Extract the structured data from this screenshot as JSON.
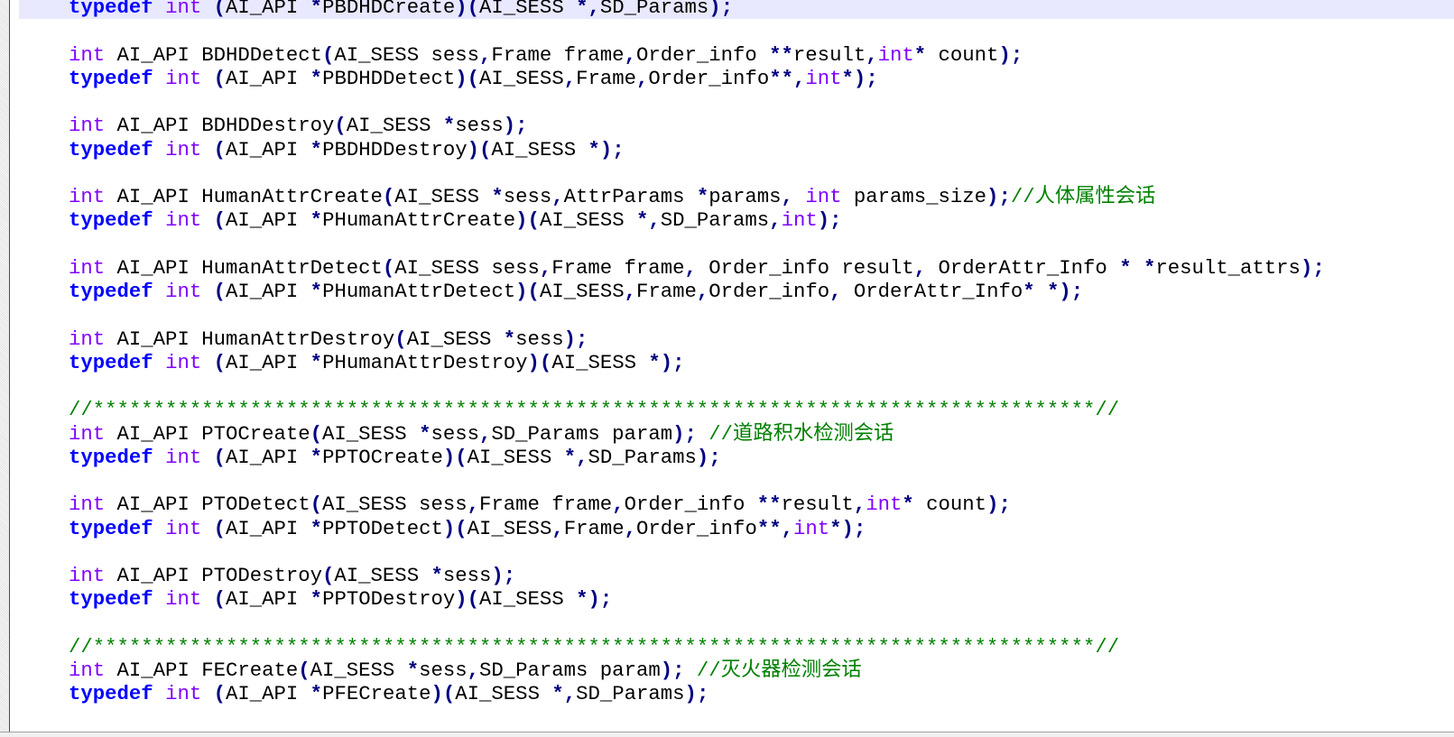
{
  "editor": {
    "current_line_index": 0,
    "colors": {
      "keyword": "#0000ff",
      "type": "#8000ff",
      "operator": "#000080",
      "comment": "#008000",
      "current_line": "#e8e8ff",
      "edge_line": "#ff0000"
    },
    "lines": [
      "typedef int (AI_API *PBDHDCreate)(AI_SESS *,SD_Params);",
      "",
      "int AI_API BDHDDetect(AI_SESS sess,Frame frame,Order_info **result,int* count);",
      "typedef int (AI_API *PBDHDDetect)(AI_SESS,Frame,Order_info**,int*);",
      "",
      "int AI_API BDHDDestroy(AI_SESS *sess);",
      "typedef int (AI_API *PBDHDDestroy)(AI_SESS *);",
      "",
      "int AI_API HumanAttrCreate(AI_SESS *sess,AttrParams *params, int params_size);//人体属性会话",
      "typedef int (AI_API *PHumanAttrCreate)(AI_SESS *,SD_Params,int);",
      "",
      "int AI_API HumanAttrDetect(AI_SESS sess,Frame frame, Order_info result, OrderAttr_Info * *result_attrs);",
      "typedef int (AI_API *PHumanAttrDetect)(AI_SESS,Frame,Order_info, OrderAttr_Info* *);",
      "",
      "int AI_API HumanAttrDestroy(AI_SESS *sess);",
      "typedef int (AI_API *PHumanAttrDestroy)(AI_SESS *);",
      "",
      "//***********************************************************************************//",
      "int AI_API PTOCreate(AI_SESS *sess,SD_Params param); //道路积水检测会话",
      "typedef int (AI_API *PPTOCreate)(AI_SESS *,SD_Params);",
      "",
      "int AI_API PTODetect(AI_SESS sess,Frame frame,Order_info **result,int* count);",
      "typedef int (AI_API *PPTODetect)(AI_SESS,Frame,Order_info**,int*);",
      "",
      "int AI_API PTODestroy(AI_SESS *sess);",
      "typedef int (AI_API *PPTODestroy)(AI_SESS *);",
      "",
      "//***********************************************************************************//",
      "int AI_API FECreate(AI_SESS *sess,SD_Params param); //灭火器检测会话",
      "typedef int (AI_API *PFECreate)(AI_SESS *,SD_Params);"
    ]
  }
}
